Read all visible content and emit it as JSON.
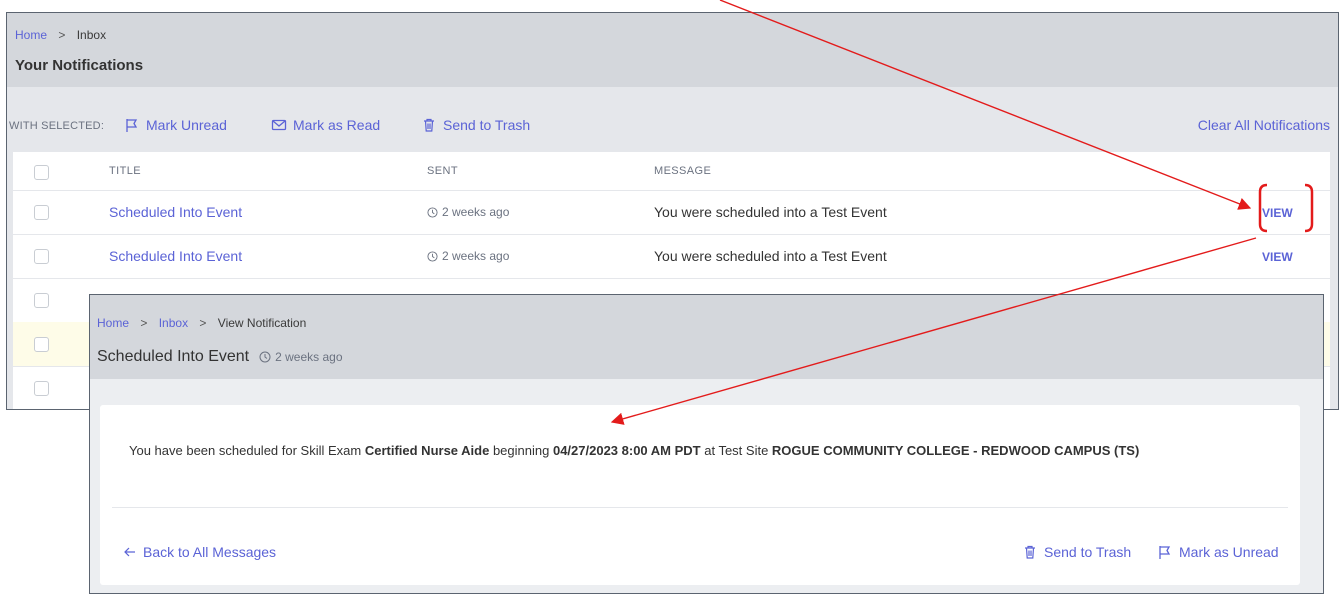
{
  "background_view": {
    "breadcrumb": {
      "home": "Home",
      "separator": ">",
      "current": "Inbox"
    },
    "page_title": "Your Notifications",
    "toolbar": {
      "with_selected": "WITH SELECTED:",
      "mark_unread": "Mark Unread",
      "mark_as_read": "Mark as Read",
      "send_to_trash": "Send to Trash",
      "clear_all": "Clear All Notifications"
    },
    "table": {
      "columns": [
        "TITLE",
        "SENT",
        "MESSAGE"
      ],
      "rows": [
        {
          "title": "Scheduled Into Event",
          "sent": "2 weeks ago",
          "message": "You were scheduled into a Test Event",
          "action": "VIEW"
        },
        {
          "title": "Scheduled Into Event",
          "sent": "2 weeks ago",
          "message": "You were scheduled into a Test Event",
          "action": "VIEW"
        }
      ]
    }
  },
  "foreground_view": {
    "breadcrumb": {
      "home": "Home",
      "separator": ">",
      "inbox": "Inbox",
      "current": "View Notification"
    },
    "title": "Scheduled Into Event",
    "sent": "2 weeks ago",
    "message": {
      "p1": "You have been scheduled for Skill Exam ",
      "exam": "Certified Nurse Aide",
      "p2": " beginning ",
      "datetime": "04/27/2023 8:00 AM PDT",
      "p3": " at Test Site ",
      "site": "ROGUE COMMUNITY COLLEGE - REDWOOD CAMPUS (TS)"
    },
    "back_link": "Back to All Messages",
    "send_to_trash": "Send to Trash",
    "mark_as_unread": "Mark as Unread"
  },
  "colors": {
    "link": "#5b63d6",
    "annotation": "#e31b1b",
    "header_bg": "#d4d7dc",
    "highlight_row": "#fefce8"
  },
  "icons": [
    "flag-icon",
    "envelope-icon",
    "trash-icon",
    "clock-icon",
    "arrow-left-icon"
  ]
}
